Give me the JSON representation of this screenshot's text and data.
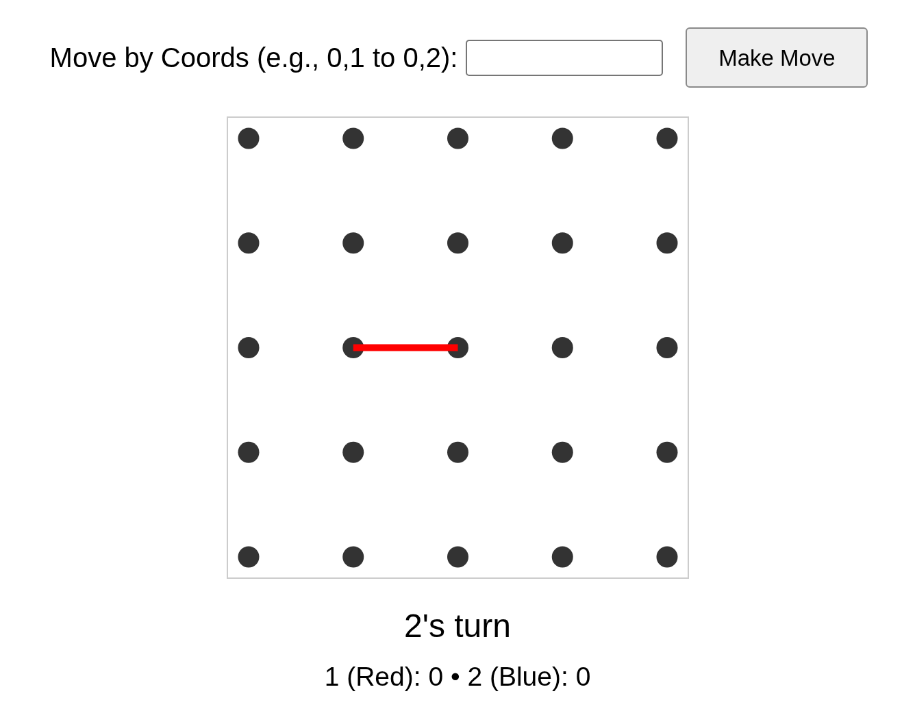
{
  "move_form": {
    "label": "Move by Coords (e.g., 0,1 to 0,2):",
    "button": "Make Move"
  },
  "board": {
    "rows": [
      [
        {
          "right_line": false,
          "down_line": false
        },
        {
          "right_line": false,
          "down_line": false
        },
        {
          "right_line": false,
          "down_line": false
        },
        {
          "right_line": false,
          "down_line": false
        },
        {
          "down_line": false
        }
      ],
      [
        {
          "right_line": false,
          "down_line": false
        },
        {
          "right_line": false,
          "down_line": false
        },
        {
          "right_line": false,
          "down_line": false
        },
        {
          "right_line": false,
          "down_line": false
        },
        {
          "down_line": false
        }
      ],
      [
        {
          "right_line": false,
          "down_line": false
        },
        {
          "right_line": true,
          "down_line": false,
          "color": "#ff0000"
        },
        {
          "right_line": false,
          "down_line": false
        },
        {
          "right_line": false,
          "down_line": false
        },
        {
          "down_line": false
        }
      ],
      [
        {
          "right_line": false,
          "down_line": false
        },
        {
          "right_line": false,
          "down_line": false
        },
        {
          "right_line": false,
          "down_line": false
        },
        {
          "right_line": false,
          "down_line": false
        },
        {
          "down_line": false
        }
      ],
      [
        {
          "right_line": false
        },
        {
          "right_line": false
        },
        {
          "right_line": false
        },
        {
          "right_line": false
        },
        {}
      ]
    ]
  },
  "status": {
    "turn": "2's turn",
    "score": "1 (Red): 0 • 2 (Blue): 0"
  }
}
